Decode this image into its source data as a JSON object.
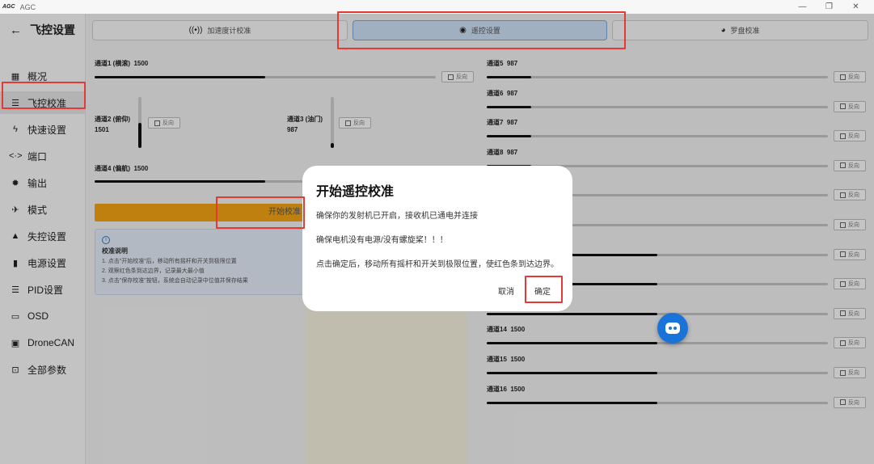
{
  "window": {
    "logo": "AGC",
    "app_name": "AGC",
    "minimize": "—",
    "maximize": "❐",
    "close": "✕"
  },
  "sidebar": {
    "back_icon": "arrow-left-icon",
    "title": "飞控设置",
    "items": [
      {
        "label": "概况",
        "icon": "grid-icon",
        "glyph": "▦"
      },
      {
        "label": "飞控校准",
        "icon": "sliders-icon",
        "glyph": "☰",
        "active": true
      },
      {
        "label": "快速设置",
        "icon": "bolt-icon",
        "glyph": "ϟ"
      },
      {
        "label": "端口",
        "icon": "ports-icon",
        "glyph": "<·>"
      },
      {
        "label": "输出",
        "icon": "gear-icon",
        "glyph": "✹"
      },
      {
        "label": "模式",
        "icon": "plane-icon",
        "glyph": "✈"
      },
      {
        "label": "失控设置",
        "icon": "warning-icon",
        "glyph": "▲"
      },
      {
        "label": "电源设置",
        "icon": "battery-icon",
        "glyph": "▮"
      },
      {
        "label": "PID设置",
        "icon": "sliders-icon",
        "glyph": "☰"
      },
      {
        "label": "OSD",
        "icon": "monitor-icon",
        "glyph": "▭"
      },
      {
        "label": "DroneCAN",
        "icon": "chip-icon",
        "glyph": "▣"
      },
      {
        "label": "全部参数",
        "icon": "cpu-icon",
        "glyph": "⊡"
      }
    ]
  },
  "tabs": [
    {
      "label": "加速度计校准",
      "icon": "signal-icon",
      "glyph": "((•))"
    },
    {
      "label": "遥控设置",
      "icon": "target-icon",
      "glyph": "◉",
      "active": true
    },
    {
      "label": "罗盘校准",
      "icon": "compass-icon",
      "glyph": "◕"
    }
  ],
  "reverse_label": "反向",
  "channels_left": {
    "ch1": {
      "label": "通道1 (横滚)",
      "value": "1500",
      "fraction": 0.5
    },
    "ch2": {
      "label": "通道2 (俯仰)",
      "value": "1501",
      "fraction": 0.5
    },
    "ch3": {
      "label": "通道3 (油门)",
      "value": "987",
      "fraction": 0.1
    },
    "ch4": {
      "label": "通道4 (偏航)",
      "value": "1500",
      "fraction": 0.5
    }
  },
  "channels_right": [
    {
      "label": "通道5",
      "value": "987",
      "fraction": 0.13
    },
    {
      "label": "通道6",
      "value": "987",
      "fraction": 0.13
    },
    {
      "label": "通道7",
      "value": "987",
      "fraction": 0.13
    },
    {
      "label": "通道8",
      "value": "987",
      "fraction": 0.13
    },
    {
      "label": "",
      "value": "",
      "fraction": 0.13
    },
    {
      "label": "",
      "value": "",
      "fraction": 0.13
    },
    {
      "label": "",
      "value": "",
      "fraction": 0.5
    },
    {
      "label": "",
      "value": "",
      "fraction": 0.5
    },
    {
      "label": "",
      "value": "",
      "fraction": 0.5
    },
    {
      "label": "通道14",
      "value": "1500",
      "fraction": 0.5
    },
    {
      "label": "通道15",
      "value": "1500",
      "fraction": 0.5
    },
    {
      "label": "通道16",
      "value": "1500",
      "fraction": 0.5
    }
  ],
  "start_button": "开始校准",
  "info": {
    "icon": "info-icon",
    "glyph": "i",
    "title": "校准说明",
    "lines": [
      "1. 点击\"开始校准\"后，移动所有摇杆和开关到极限位置",
      "2. 观察红色条到达边界，记录最大最小值",
      "3. 点击\"保存校准\"按钮，系统会自动记录中位值并保存结果"
    ]
  },
  "dialog": {
    "title": "开始遥控校准",
    "line1": "确保你的发射机已开启，接收机已通电并连接",
    "line2": "确保电机没有电源/没有螺旋桨！！！",
    "line3": "点击确定后，移动所有摇杆和开关到极限位置，使红色条到达边界。",
    "cancel": "取消",
    "confirm": "确定"
  },
  "assistant_icon": "robot-icon"
}
